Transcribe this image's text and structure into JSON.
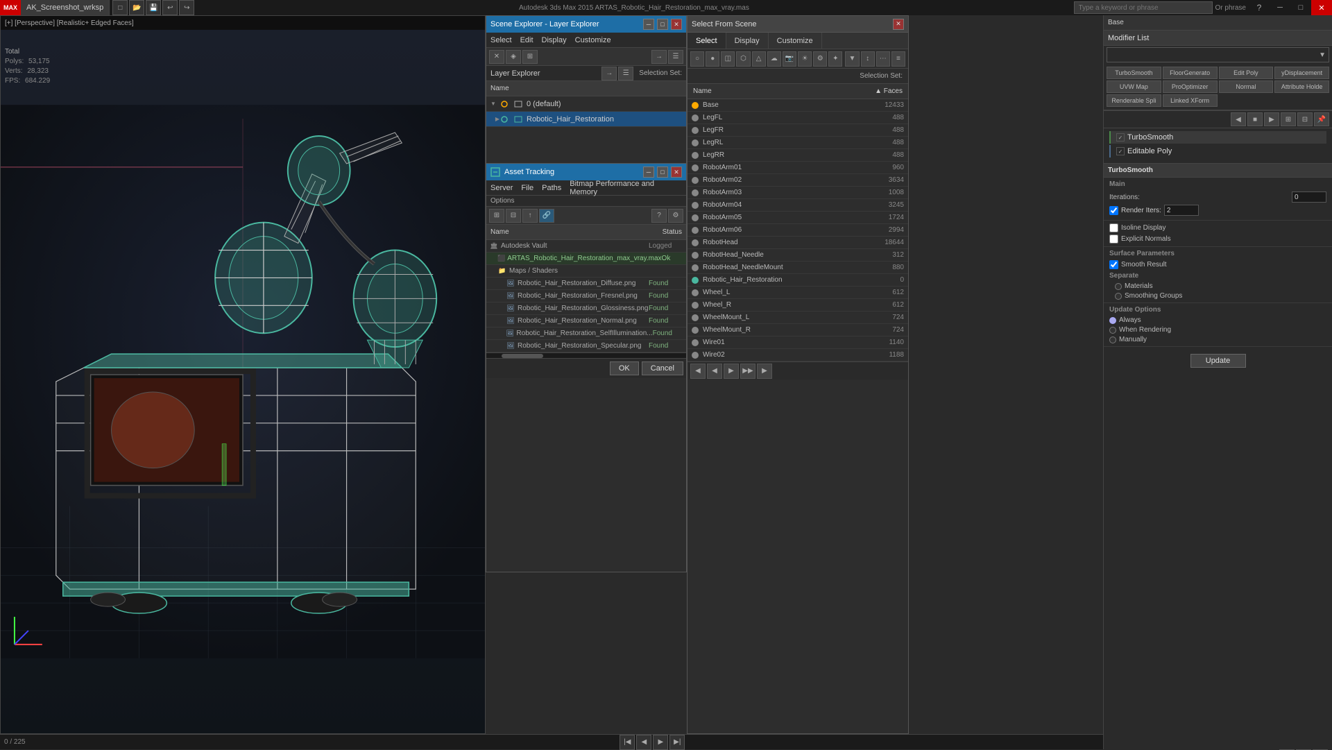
{
  "app": {
    "title": "Autodesk 3ds Max 2015   ARTAS_Robotic_Hair_Restoration_max_vray.mas",
    "tab_label": "AK_Screenshot_wrksp",
    "search_placeholder": "Type a keyword or phrase",
    "phrase_label": "Or phrase"
  },
  "viewport": {
    "label": "[+] [Perspective] [Realistic+ Edged Faces]",
    "stats": {
      "total_label": "Total",
      "polys_label": "Polys:",
      "polys_value": "53,175",
      "verts_label": "Verts:",
      "verts_value": "28,323",
      "fps_label": "FPS:",
      "fps_value": "684.229"
    }
  },
  "scene_explorer": {
    "title": "Scene Explorer - Layer Explorer",
    "menus": [
      "Select",
      "Edit",
      "Display",
      "Customize"
    ],
    "col_header": "Name",
    "layers": [
      {
        "name": "0 (default)",
        "expanded": true,
        "indent": 0
      },
      {
        "name": "Robotic_Hair_Restoration",
        "indent": 1,
        "selected": true
      }
    ],
    "sub_header": "Layer Explorer",
    "selection_set": "Selection Set:"
  },
  "asset_tracking": {
    "title": "Asset Tracking",
    "menus": [
      "Server",
      "File",
      "Paths",
      "Bitmap Performance and Memory",
      "Options"
    ],
    "col_name": "Name",
    "col_status": "Status",
    "assets": [
      {
        "name": "Autodesk Vault",
        "indent": 0,
        "status": "Logged",
        "type": "vault"
      },
      {
        "name": "ARTAS_Robotic_Hair_Restoration_max_vray.max",
        "indent": 1,
        "status": "Ok",
        "type": "file"
      },
      {
        "name": "Maps / Shaders",
        "indent": 1,
        "status": "",
        "type": "folder"
      },
      {
        "name": "Robotic_Hair_Restoration_Diffuse.png",
        "indent": 2,
        "status": "Found",
        "type": "image"
      },
      {
        "name": "Robotic_Hair_Restoration_Fresnel.png",
        "indent": 2,
        "status": "Found",
        "type": "image"
      },
      {
        "name": "Robotic_Hair_Restoration_Glossiness.png",
        "indent": 2,
        "status": "Found",
        "type": "image"
      },
      {
        "name": "Robotic_Hair_Restoration_Normal.png",
        "indent": 2,
        "status": "Found",
        "type": "image"
      },
      {
        "name": "Robotic_Hair_Restoration_SelfIllumination...",
        "indent": 2,
        "status": "Found",
        "type": "image"
      },
      {
        "name": "Robotic_Hair_Restoration_Specular.png",
        "indent": 2,
        "status": "Found",
        "type": "image"
      }
    ],
    "ok_label": "OK",
    "cancel_label": "Cancel"
  },
  "select_from_scene": {
    "title": "Select From Scene",
    "tabs": [
      "Select",
      "Display",
      "Customize"
    ],
    "col_name": "Name",
    "col_faces": "▲ Faces",
    "objects": [
      {
        "name": "Base",
        "faces": 12433,
        "active": true
      },
      {
        "name": "LegFL",
        "faces": 488
      },
      {
        "name": "LegFR",
        "faces": 488
      },
      {
        "name": "LegRL",
        "faces": 488
      },
      {
        "name": "LegRR",
        "faces": 488
      },
      {
        "name": "RobotArm01",
        "faces": 960
      },
      {
        "name": "RobotArm02",
        "faces": 3634
      },
      {
        "name": "RobotArm03",
        "faces": 1008
      },
      {
        "name": "RobotArm04",
        "faces": 3245
      },
      {
        "name": "RobotArm05",
        "faces": 1724
      },
      {
        "name": "RobotArm06",
        "faces": 2994
      },
      {
        "name": "RobotHead",
        "faces": 18644
      },
      {
        "name": "RobotHead_Needle",
        "faces": 312
      },
      {
        "name": "RobotHead_NeedleMount",
        "faces": 880
      },
      {
        "name": "Robotic_Hair_Restoration",
        "faces": 0
      },
      {
        "name": "Wheel_L",
        "faces": 612
      },
      {
        "name": "Wheel_R",
        "faces": 612
      },
      {
        "name": "WheelMount_L",
        "faces": 724
      },
      {
        "name": "WheelMount_R",
        "faces": 724
      },
      {
        "name": "Wire01",
        "faces": 1140
      },
      {
        "name": "Wire02",
        "faces": 1188
      }
    ]
  },
  "modifier_panel": {
    "base_label": "Base",
    "modifier_list_label": "Modifier List",
    "grid_modifiers": [
      "TurboSmooth",
      "FloorGenerato",
      "Edit Poly",
      "yDisplacement",
      "UVW Map",
      "ProOptimizer",
      "Normal",
      "Attribute Holde",
      "Renderable Spli",
      "Linked XForm"
    ],
    "stack": [
      {
        "name": "TurboSmooth",
        "selected": false,
        "enabled": true
      },
      {
        "name": "Editable Poly",
        "selected": true,
        "enabled": true
      }
    ],
    "turbosmooth_section": {
      "title": "TurboSmooth",
      "main_label": "Main",
      "iterations_label": "Iterations:",
      "iterations_value": "0",
      "render_iters_label": "Render Iters:",
      "render_iters_value": "2",
      "isoline_display_label": "Isoline Display",
      "explicit_normals_label": "Explicit Normals",
      "surface_params_label": "Surface Parameters",
      "smooth_result_label": "Smooth Result",
      "smooth_result_checked": true,
      "separate_label": "Separate",
      "materials_label": "Materials",
      "smoothing_groups_label": "Smoothing Groups",
      "update_options_label": "Update Options",
      "always_label": "Always",
      "when_rendering_label": "When Rendering",
      "manually_label": "Manually",
      "update_btn": "Update"
    }
  },
  "bottom_bar": {
    "position": "0 / 225"
  }
}
